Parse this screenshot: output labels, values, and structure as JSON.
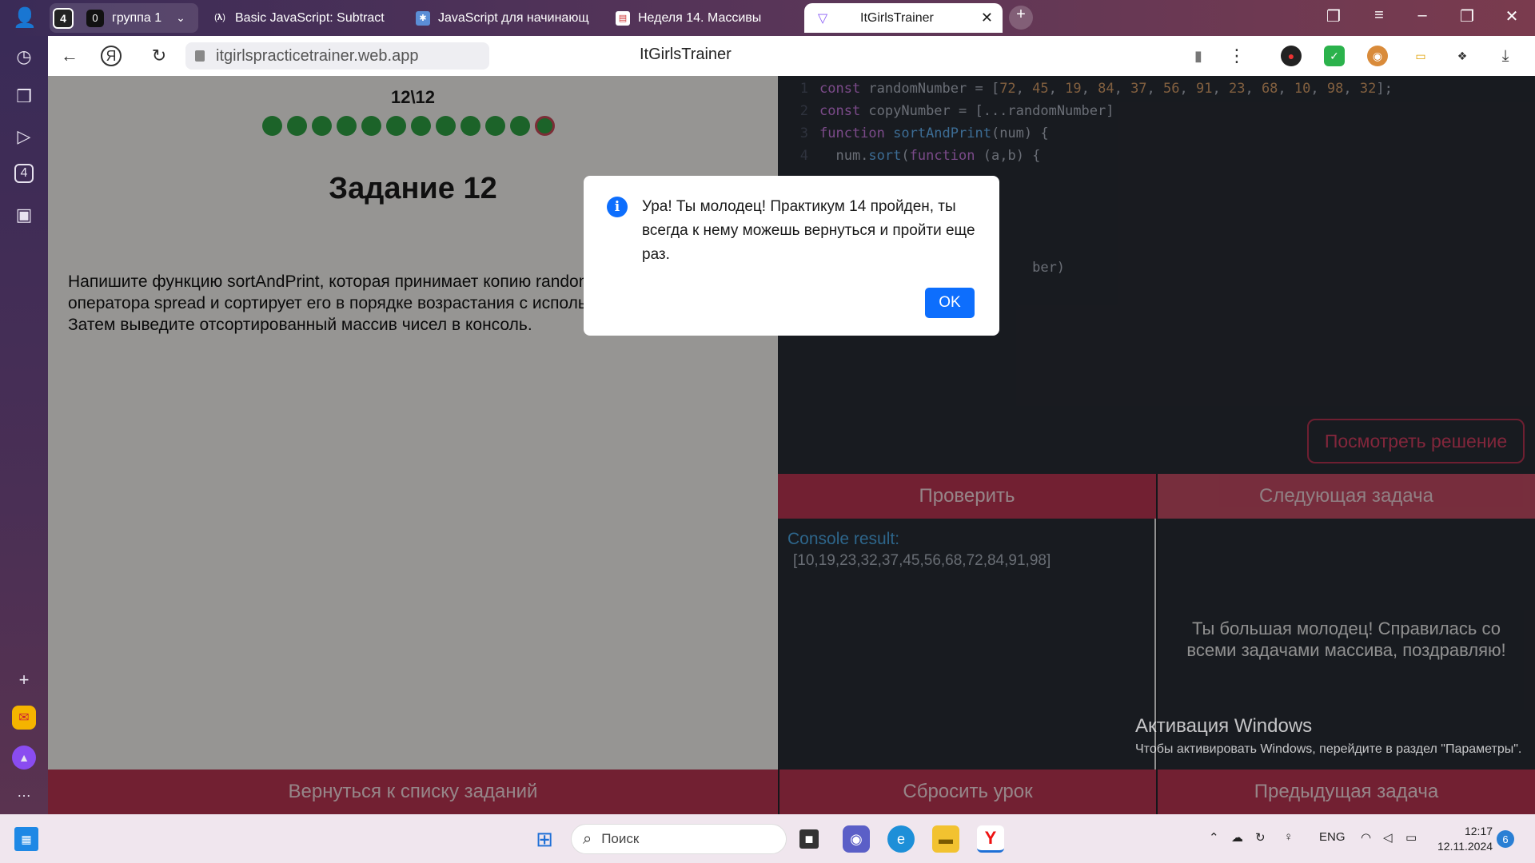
{
  "browser": {
    "group_count": "4",
    "group_chip": {
      "count": "0",
      "label": "группа 1"
    },
    "tabs": [
      {
        "label": "Basic JavaScript: Subtract",
        "icon": "freecodecamp-icon"
      },
      {
        "label": "JavaScript для начинающ",
        "icon": "code-icon"
      },
      {
        "label": "Неделя 14. Массивы",
        "icon": "doc-icon"
      },
      {
        "label": "ItGirlsTrainer",
        "icon": "vite-icon",
        "active": true
      }
    ],
    "url": "itgirlspracticetrainer.web.app",
    "page_title": "ItGirlsTrainer",
    "sidebar_badge": "4"
  },
  "task": {
    "progress_label": "12\\12",
    "dot_count": 12,
    "title": "Задание 12",
    "description": "Напишите функцию sortAndPrint, которая принимает копию randomNumbers с помощью оператора spread и сортирует его в порядке возрастания с использованием метода sort(). Затем выведите отсортированный массив чисел в консоль."
  },
  "code": {
    "lines": [
      {
        "n": "1",
        "parts": [
          [
            "kw",
            "const "
          ],
          [
            "plain",
            "randomNumber = ["
          ],
          [
            "num",
            "72"
          ],
          [
            "plain",
            ", "
          ],
          [
            "num",
            "45"
          ],
          [
            "plain",
            ", "
          ],
          [
            "num",
            "19"
          ],
          [
            "plain",
            ", "
          ],
          [
            "num",
            "84"
          ],
          [
            "plain",
            ", "
          ],
          [
            "num",
            "37"
          ],
          [
            "plain",
            ", "
          ],
          [
            "num",
            "56"
          ],
          [
            "plain",
            ", "
          ],
          [
            "num",
            "91"
          ],
          [
            "plain",
            ", "
          ],
          [
            "num",
            "23"
          ],
          [
            "plain",
            ", "
          ],
          [
            "num",
            "68"
          ],
          [
            "plain",
            ", "
          ],
          [
            "num",
            "10"
          ],
          [
            "plain",
            ", "
          ],
          [
            "num",
            "98"
          ],
          [
            "plain",
            ", "
          ],
          [
            "num",
            "32"
          ],
          [
            "plain",
            "];"
          ]
        ]
      },
      {
        "n": "2",
        "parts": [
          [
            "kw",
            "const "
          ],
          [
            "plain",
            "copyNumber = [...randomNumber]"
          ]
        ]
      },
      {
        "n": "3",
        "parts": [
          [
            "kw",
            "function "
          ],
          [
            "fn",
            "sortAndPrint"
          ],
          [
            "plain",
            "(num) {"
          ]
        ]
      },
      {
        "n": "4",
        "parts": [
          [
            "plain",
            "  num."
          ],
          [
            "fn",
            "sort"
          ],
          [
            "plain",
            "("
          ],
          [
            "kw",
            "function "
          ],
          [
            "plain",
            "(a,b) {"
          ]
        ]
      },
      {
        "n": "",
        "parts": []
      },
      {
        "n": "",
        "parts": []
      },
      {
        "n": "",
        "parts": []
      },
      {
        "n": "",
        "parts": []
      },
      {
        "n": "",
        "parts": [
          [
            "plain",
            "                          ber)"
          ]
        ]
      }
    ]
  },
  "buttons": {
    "view_solution": "Посмотреть решение",
    "check": "Проверить",
    "next_task": "Следующая задача",
    "back_to_list": "Вернуться к списку заданий",
    "reset_lesson": "Сбросить урок",
    "previous_task": "Предыдущая задача"
  },
  "console": {
    "title": "Console result:",
    "output": "[10,19,23,32,37,45,56,68,72,84,91,98]"
  },
  "congrats": "Ты большая молодец! Справилась со всеми задачами массива, поздравляю!",
  "dialog": {
    "message": "Ура! Ты молодец! Практикум 14 пройден, ты всегда к нему можешь вернуться и пройти еще раз.",
    "ok": "OK"
  },
  "watermark": {
    "title": "Активация Windows",
    "text": "Чтобы активировать Windows, перейдите в раздел \"Параметры\"."
  },
  "taskbar": {
    "search_placeholder": "Поиск",
    "language": "ENG",
    "time": "12:17",
    "date": "12.11.2024",
    "notifications": "6"
  },
  "colors": {
    "accent_red": "#b83552",
    "dot_green": "#2ea043",
    "dialog_blue": "#0d6efd",
    "console_blue": "#4aa3df"
  }
}
